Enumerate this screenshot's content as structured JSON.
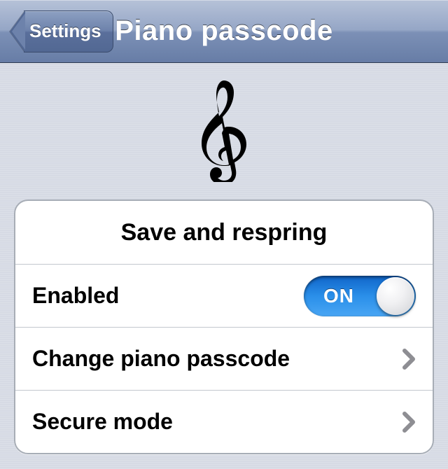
{
  "nav": {
    "back_label": "Settings",
    "title": "Piano passcode"
  },
  "icon": {
    "name": "treble-clef-icon"
  },
  "settings": {
    "rows": [
      {
        "label": "Save and respring"
      },
      {
        "label": "Enabled",
        "toggle_label": "ON",
        "toggle_on": true
      },
      {
        "label": "Change piano passcode"
      },
      {
        "label": "Secure mode"
      }
    ]
  }
}
